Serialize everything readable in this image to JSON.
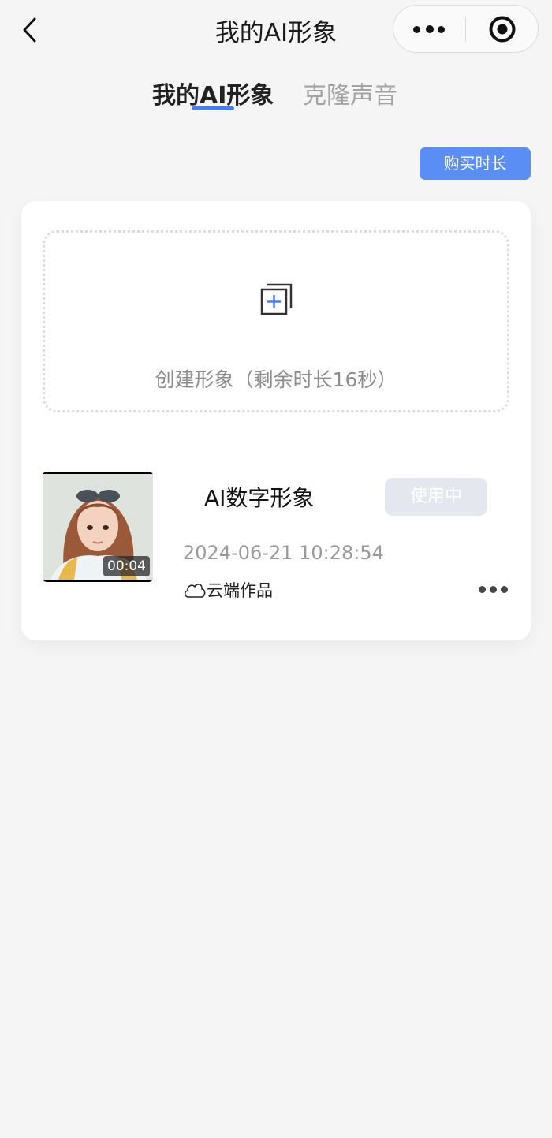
{
  "nav": {
    "title": "我的AI形象"
  },
  "tabs": [
    {
      "label": "我的AI形象",
      "active": true
    },
    {
      "label": "克隆声音",
      "active": false
    }
  ],
  "buy_button": "购买时长",
  "create": {
    "label": "创建形象（剩余时长16秒）"
  },
  "avatar": {
    "duration": "00:04",
    "title": "AI数字形象",
    "status": "使用中",
    "timestamp": "2024-06-21 10:28:54",
    "storage_label": "云端作品"
  },
  "colors": {
    "accent": "#4a7df0",
    "button": "#5b8ef5",
    "disabled_button": "#e4e8ee",
    "background": "#f5f5f5"
  }
}
